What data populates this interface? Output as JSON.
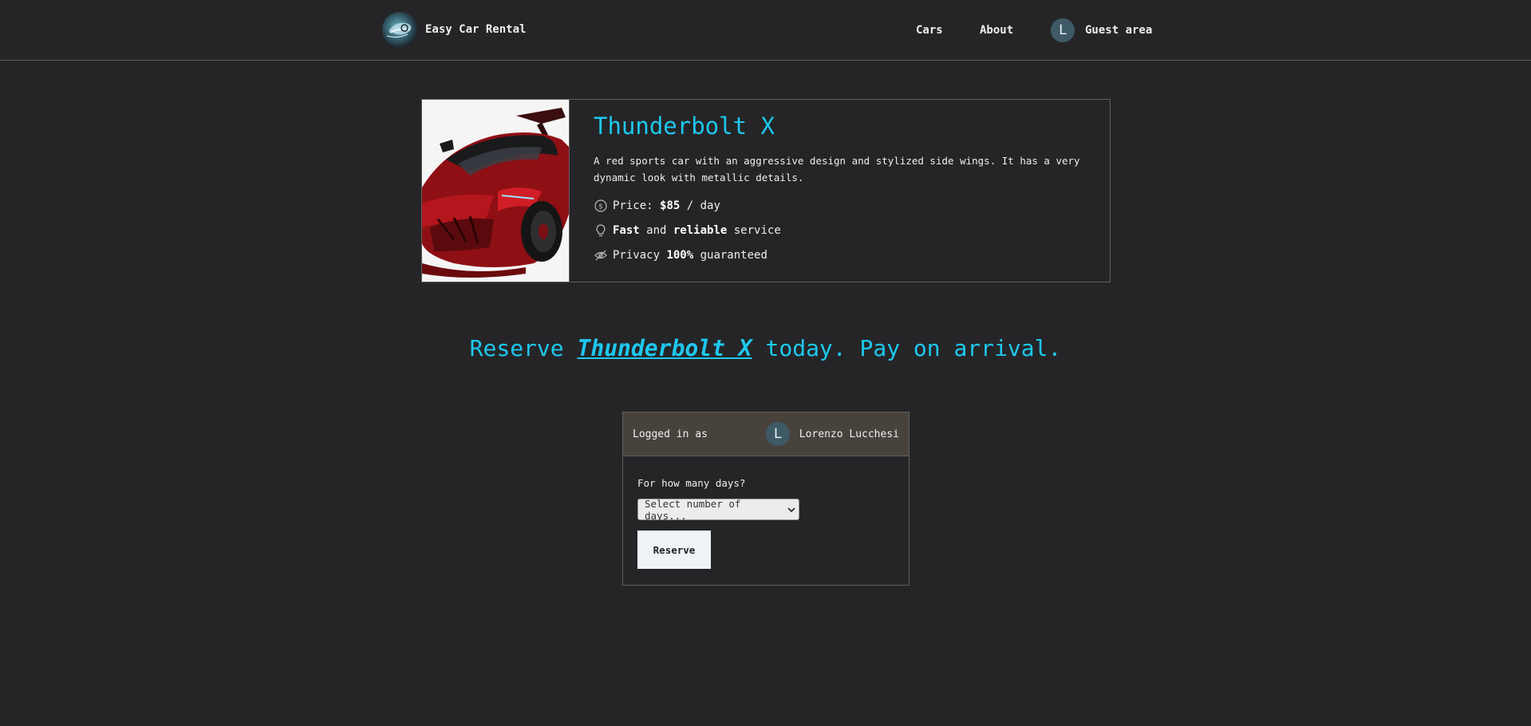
{
  "header": {
    "brand_name": "Easy Car Rental",
    "nav": {
      "cars": "Cars",
      "about": "About",
      "guest_avatar_letter": "L",
      "guest_area": "Guest area"
    }
  },
  "car": {
    "title": "Thunderbolt X",
    "description": "A red sports car with an aggressive design and stylized side wings. It has a very dynamic look with metallic details.",
    "features": {
      "price_prefix": "Price: ",
      "price_value": "$85",
      "price_suffix": " / day",
      "fast": "Fast",
      "and": " and ",
      "reliable": "reliable",
      "service": " service",
      "privacy_prefix": "Privacy ",
      "privacy_value": "100%",
      "privacy_suffix": " guaranteed"
    }
  },
  "headline": {
    "prefix": "Reserve ",
    "car_link": "Thunderbolt X",
    "suffix": " today. Pay on arrival."
  },
  "reserve": {
    "logged_in_label": "Logged in as",
    "user_avatar_letter": "L",
    "user_name": "Lorenzo Lucchesi",
    "days_question": "For how many days?",
    "days_select_value": "Select number of days...",
    "button_label": "Reserve"
  },
  "icons": {
    "price": "dollar-circle-icon",
    "service": "lightbulb-icon",
    "privacy": "eye-off-icon"
  },
  "colors": {
    "background": "#252527",
    "accent": "#1ec8ee",
    "reserve_header": "#48423d",
    "avatar": "#3e5a66"
  }
}
